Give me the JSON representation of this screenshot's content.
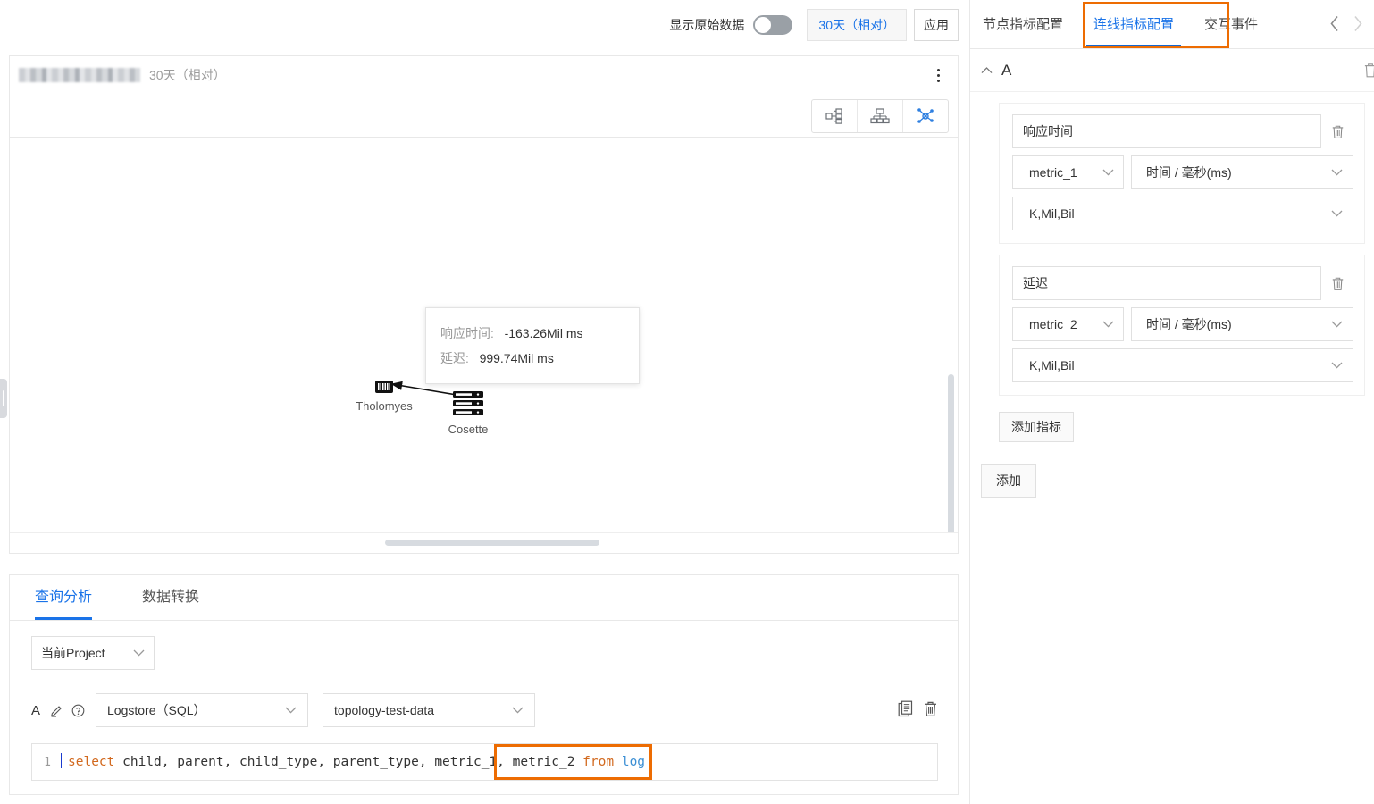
{
  "toolbar": {
    "raw_data_label": "显示原始数据",
    "raw_data_toggle_state": "off",
    "time_range": "30天（相对）",
    "apply_label": "应用"
  },
  "chart_card": {
    "title_blurred": "",
    "subtitle": "30天（相对）",
    "kebab_icon": "more-vertical-icon",
    "layout_buttons": [
      {
        "name": "tree-layout-icon",
        "active": false
      },
      {
        "name": "hierarchy-layout-icon",
        "active": false
      },
      {
        "name": "force-layout-icon",
        "active": true
      }
    ],
    "tooltip": {
      "rows": [
        {
          "key": "响应时间:",
          "value": "-163.26Mil ms"
        },
        {
          "key": "延迟:",
          "value": "999.74Mil ms"
        }
      ]
    },
    "nodes": [
      {
        "label": "Tholomyes",
        "icon": "gateway-node-icon"
      },
      {
        "label": "Cosette",
        "icon": "server-node-icon"
      }
    ]
  },
  "query_panel": {
    "tabs": [
      {
        "label": "查询分析",
        "active": true
      },
      {
        "label": "数据转换",
        "active": false
      }
    ],
    "project_select": "当前Project",
    "row": {
      "letter": "A",
      "edit_icon": "pencil-icon",
      "help_icon": "question-circle-icon",
      "source_type": "Logstore（SQL）",
      "logstore": "topology-test-data",
      "copy_icon": "copy-icon",
      "delete_icon": "trash-icon"
    },
    "editor": {
      "line_number": "1",
      "sql_segments": [
        {
          "text": "select ",
          "type": "kw"
        },
        {
          "text": "child, parent, child_type, parent_type, ",
          "type": "plain"
        },
        {
          "text": "metric_1, metric_2",
          "type": "plain"
        },
        {
          "text": " from ",
          "type": "kw"
        },
        {
          "text": "log",
          "type": "tbl"
        }
      ],
      "highlight_text": "metric_1, metric_2",
      "highlight_color": "#ed6c02"
    }
  },
  "right_panel": {
    "tabs": [
      {
        "label": "节点指标配置",
        "active": false
      },
      {
        "label": "连线指标配置",
        "active": true
      },
      {
        "label": "交互事件",
        "active": false
      }
    ],
    "highlight_color": "#ed6c02",
    "accent_color": "#1a73e8",
    "nav": {
      "prev_icon": "chevron-left-icon",
      "next_icon": "chevron-right-icon",
      "prev_enabled": true,
      "next_enabled": false
    },
    "group": {
      "collapse_icon": "chevron-up-icon",
      "title": "A",
      "delete_icon": "trash-icon"
    },
    "metrics": [
      {
        "alias": "响应时间",
        "delete_icon": "trash-icon",
        "field": "metric_1",
        "unit": "时间 / 毫秒(ms)",
        "format": "K,Mil,Bil"
      },
      {
        "alias": "延迟",
        "delete_icon": "trash-icon",
        "field": "metric_2",
        "unit": "时间 / 毫秒(ms)",
        "format": "K,Mil,Bil"
      }
    ],
    "add_metric_label": "添加指标",
    "add_label": "添加"
  }
}
